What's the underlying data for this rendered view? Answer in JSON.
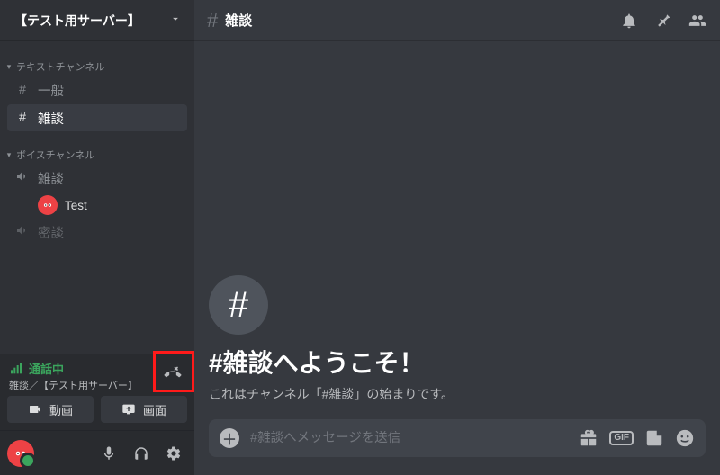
{
  "server": {
    "name": "【テスト用サーバー】"
  },
  "categories": {
    "text": {
      "label": "テキストチャンネル",
      "channels": [
        {
          "name": "一般"
        },
        {
          "name": "雑談"
        }
      ]
    },
    "voice": {
      "label": "ボイスチャンネル",
      "channels": [
        {
          "name": "雑談",
          "members": [
            {
              "name": "Test"
            }
          ]
        },
        {
          "name": "密談"
        }
      ]
    }
  },
  "voice_panel": {
    "status": "通話中",
    "path": "雑談／【テスト用サーバー】",
    "video_btn": "動画",
    "screen_btn": "画面"
  },
  "channel_view": {
    "name": "雑談",
    "welcome_title": "#雑談へようこそ！",
    "welcome_sub": "これはチャンネル「#雑談」の始まりです。",
    "composer_placeholder": "#雑談へメッセージを送信"
  },
  "composer_gif_label": "GIF"
}
